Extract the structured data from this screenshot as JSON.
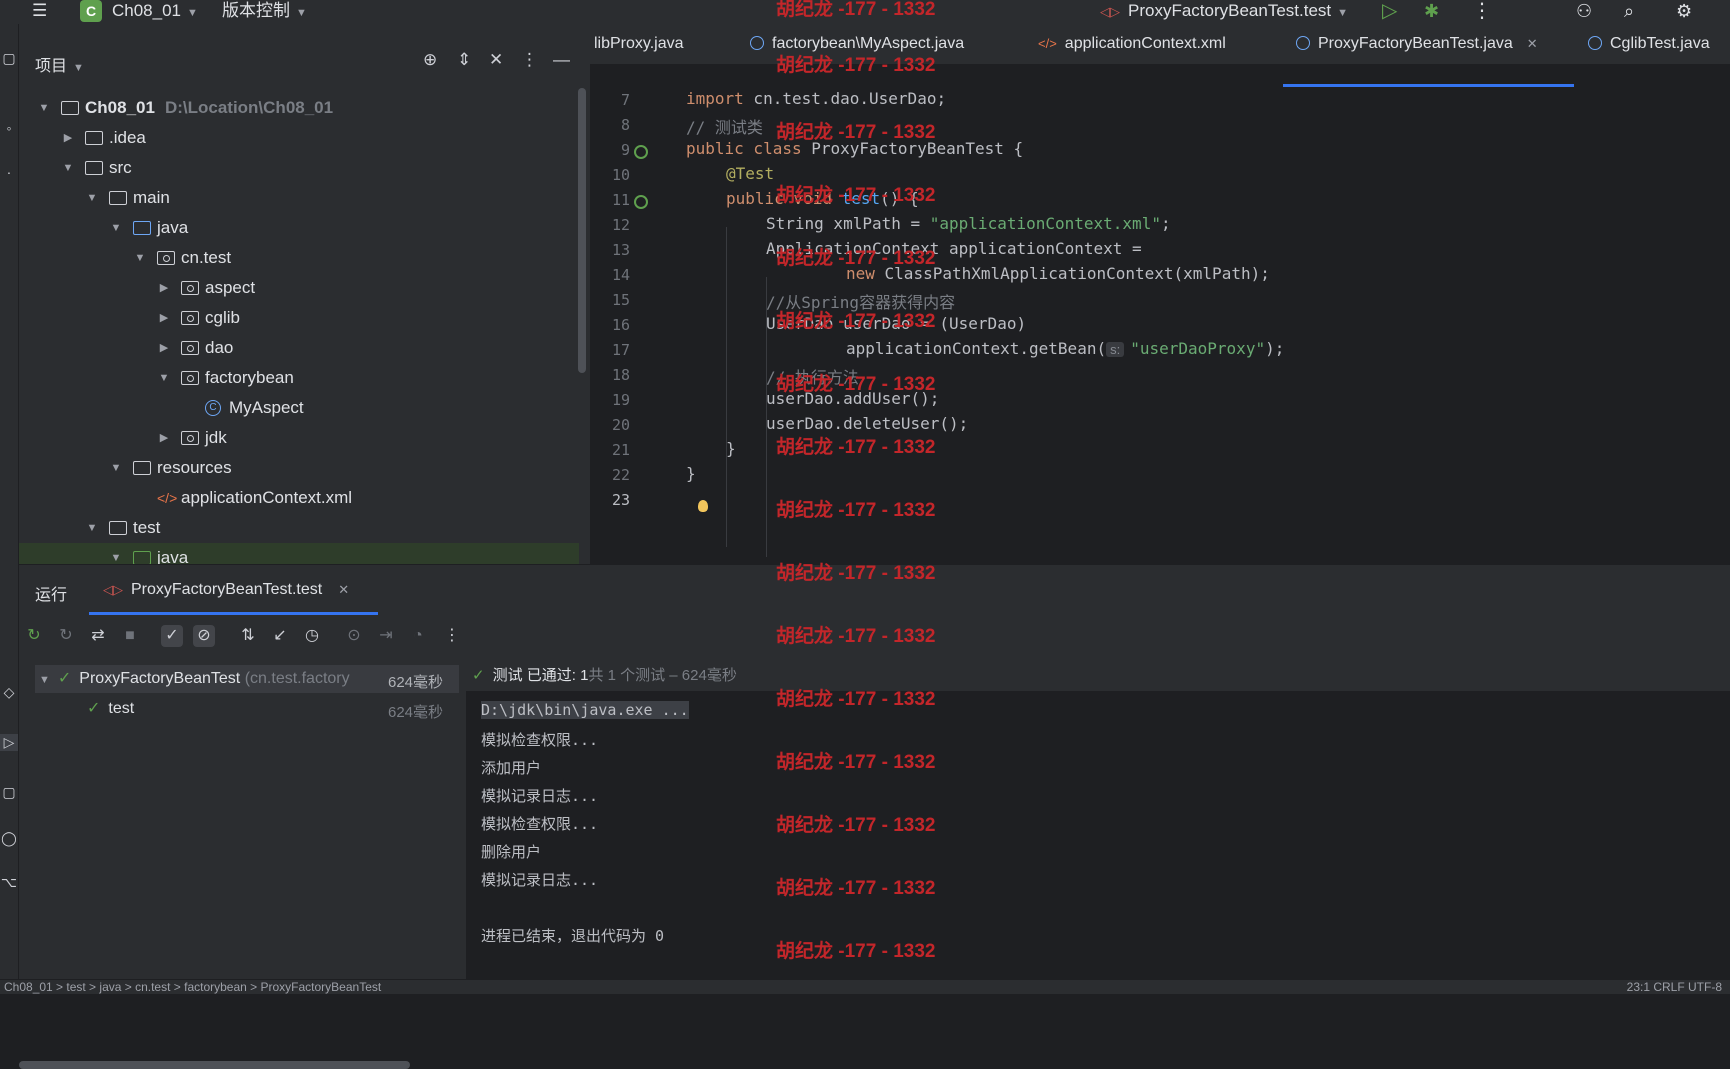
{
  "titlebar": {
    "project_badge": "C",
    "project_name": "Ch08_01",
    "vcs_menu": "版本控制",
    "run_config": "ProxyFactoryBeanTest.test"
  },
  "project_panel": {
    "title": "项目",
    "tree": [
      {
        "label": "Ch08_01",
        "path": "D:\\Location\\Ch08_01"
      },
      {
        "label": ".idea"
      },
      {
        "label": "src"
      },
      {
        "label": "main"
      },
      {
        "label": "java"
      },
      {
        "label": "cn.test"
      },
      {
        "label": "aspect"
      },
      {
        "label": "cglib"
      },
      {
        "label": "dao"
      },
      {
        "label": "factorybean"
      },
      {
        "label": "MyAspect"
      },
      {
        "label": "jdk"
      },
      {
        "label": "resources"
      },
      {
        "label": "applicationContext.xml"
      },
      {
        "label": "test"
      },
      {
        "label": "java"
      }
    ]
  },
  "editor": {
    "tabs": [
      {
        "label": "libProxy.java"
      },
      {
        "label": "factorybean\\MyAspect.java"
      },
      {
        "label": "applicationContext.xml"
      },
      {
        "label": "ProxyFactoryBeanTest.java",
        "active": true
      },
      {
        "label": "CglibTest.java"
      }
    ],
    "line_numbers": [
      "7",
      "8",
      "9",
      "10",
      "11",
      "12",
      "13",
      "14",
      "15",
      "16",
      "17",
      "18",
      "19",
      "20",
      "21",
      "22",
      "23"
    ],
    "code": {
      "l7_kw": "import",
      "l7_rest": " cn.test.dao.UserDao;",
      "l8": "// 测试类",
      "l9_kw": "public class",
      "l9_rest": " ProxyFactoryBeanTest {",
      "l10": "@Test",
      "l11_kw": "public void",
      "l11_fn": "test",
      "l11_rest": "() {",
      "l12_a": "String xmlPath = ",
      "l12_str": "\"applicationContext.xml\"",
      "l12_b": ";",
      "l13": "ApplicationContext applicationContext =",
      "l14_kw": "new",
      "l14_rest": " ClassPathXmlApplicationContext(xmlPath);",
      "l15": "//从Spring容器获得内容",
      "l16": "UserDao userDao = (UserDao)",
      "l17_a": "applicationContext.getBean(",
      "l17_hint": "s:",
      "l17_str": "\"userDaoProxy\"",
      "l17_b": ");",
      "l18": "// 执行方法",
      "l19": "userDao.addUser();",
      "l20": "userDao.deleteUser();",
      "l21": "}",
      "l22": "}"
    }
  },
  "run_panel": {
    "title": "运行",
    "tab": "ProxyFactoryBeanTest.test",
    "tests": {
      "root_name": "ProxyFactoryBeanTest",
      "root_pkg": "(cn.test.factory",
      "root_time": "624毫秒",
      "child_name": "test",
      "child_time": "624毫秒"
    },
    "status": {
      "passed": "测试 已通过: 1",
      "summary": "共 1 个测试 – 624毫秒"
    },
    "console": [
      "D:\\jdk\\bin\\java.exe ...",
      "模拟检查权限...",
      "添加用户",
      "模拟记录日志...",
      "模拟检查权限...",
      "删除用户",
      "模拟记录日志...",
      "",
      "进程已结束，退出代码为 0"
    ]
  },
  "statusbar": {
    "breadcrumb": "Ch08_01 > test > java > cn.test > factorybean > ProxyFactoryBeanTest",
    "right": "23:1  CRLF  UTF-8"
  },
  "watermark": "胡纪龙 -177 - 1332"
}
